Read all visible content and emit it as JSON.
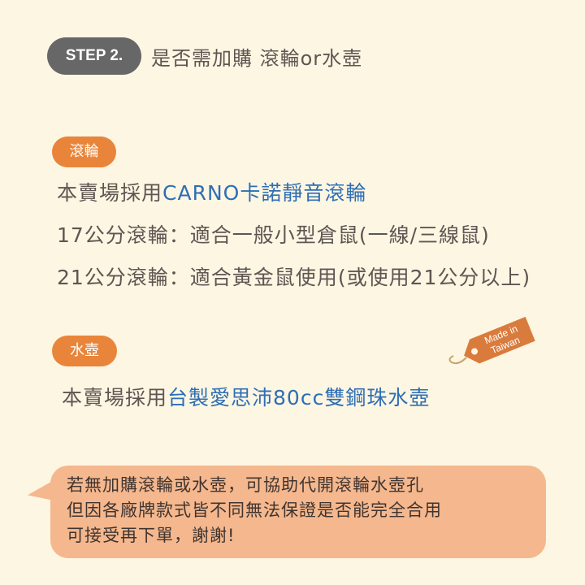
{
  "step": {
    "label": "STEP 2.",
    "title": "是否需加購 滾輪or水壺"
  },
  "wheel": {
    "tag": "滾輪",
    "line1_prefix": "本賣場採用",
    "line1_highlight": "CARNO卡諾靜音滾輪",
    "line2": "17公分滾輪：適合一般小型倉鼠(一線/三線鼠)",
    "line3": "21公分滾輪：適合黃金鼠使用(或使用21公分以上)"
  },
  "bottle": {
    "tag": "水壺",
    "line_prefix": "本賣場採用",
    "line_highlight": "台製愛思沛80cc雙鋼珠水壺"
  },
  "made_in_tag": {
    "line1": "Made in",
    "line2": "Taiwan",
    "color": "#d97b3c"
  },
  "note": {
    "line1": "若無加購滾輪或水壺，可協助代開滾輪水壺孔",
    "line2": "但因各廠牌款式皆不同無法保證是否能完全合用",
    "line3": "可接受再下單，謝謝!"
  },
  "colors": {
    "background": "#fdf6e3",
    "step_pill": "#686767",
    "tag_orange": "#e9853a",
    "highlight_blue": "#2e6eb5",
    "bubble": "#f5b78d"
  }
}
